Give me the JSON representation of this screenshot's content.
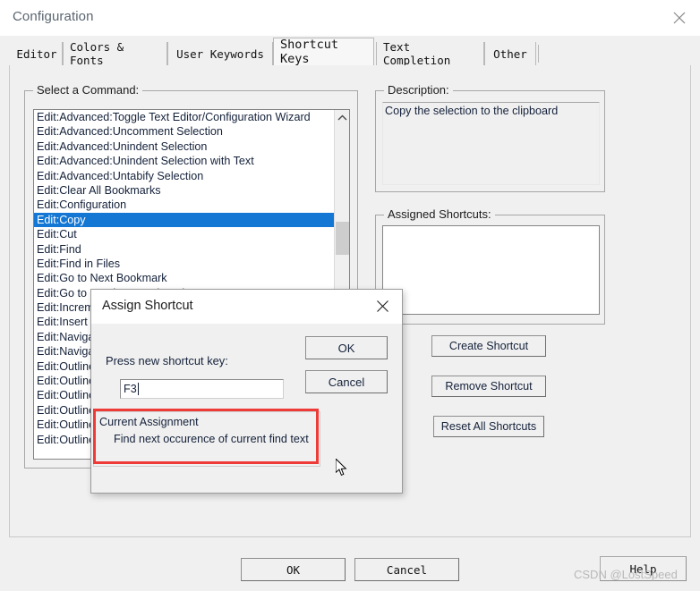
{
  "window": {
    "title": "Configuration",
    "close_icon": "close-icon"
  },
  "tabs": [
    {
      "label": "Editor",
      "active": false
    },
    {
      "label": "Colors & Fonts",
      "active": false
    },
    {
      "label": "User Keywords",
      "active": false
    },
    {
      "label": "Shortcut Keys",
      "active": true
    },
    {
      "label": "Text Completion",
      "active": false
    },
    {
      "label": "Other",
      "active": false
    }
  ],
  "command_group": {
    "label": "Select a Command:",
    "items": [
      {
        "text": "Edit:Advanced:Toggle Text Editor/Configuration Wizard",
        "selected": false
      },
      {
        "text": "Edit:Advanced:Uncomment Selection",
        "selected": false
      },
      {
        "text": "Edit:Advanced:Unindent Selection",
        "selected": false
      },
      {
        "text": "Edit:Advanced:Unindent Selection with Text",
        "selected": false
      },
      {
        "text": "Edit:Advanced:Untabify Selection",
        "selected": false
      },
      {
        "text": "Edit:Clear All Bookmarks",
        "selected": false
      },
      {
        "text": "Edit:Configuration",
        "selected": false
      },
      {
        "text": "Edit:Copy",
        "selected": true
      },
      {
        "text": "Edit:Cut",
        "selected": false
      },
      {
        "text": "Edit:Find",
        "selected": false
      },
      {
        "text": "Edit:Find in Files",
        "selected": false
      },
      {
        "text": "Edit:Go to Next Bookmark",
        "selected": false
      },
      {
        "text": "Edit:Go to Previous Bookmark",
        "selected": false
      },
      {
        "text": "Edit:Increment",
        "selected": false
      },
      {
        "text": "Edit:Insert",
        "selected": false
      },
      {
        "text": "Edit:Navigate",
        "selected": false
      },
      {
        "text": "Edit:Navigate",
        "selected": false
      },
      {
        "text": "Edit:Outline",
        "selected": false
      },
      {
        "text": "Edit:Outline",
        "selected": false
      },
      {
        "text": "Edit:Outline",
        "selected": false
      },
      {
        "text": "Edit:Outline",
        "selected": false
      },
      {
        "text": "Edit:Outline",
        "selected": false
      },
      {
        "text": "Edit:Outline",
        "selected": false
      }
    ],
    "scrollbar": {
      "up_arrow_icon": "chevron-up-icon"
    }
  },
  "description_group": {
    "label": "Description:",
    "text": "Copy the selection to the clipboard"
  },
  "assigned_group": {
    "label": "Assigned Shortcuts:",
    "items": []
  },
  "side_buttons": {
    "create": "Create Shortcut",
    "remove": "Remove Shortcut",
    "reset": "Reset All Shortcuts"
  },
  "footer": {
    "ok": "OK",
    "cancel": "Cancel",
    "help": "Help"
  },
  "dialog": {
    "title": "Assign Shortcut",
    "close_icon": "close-icon",
    "prompt": "Press new shortcut key:",
    "input_value": "F3",
    "input_placeholder": "",
    "ok": "OK",
    "cancel": "Cancel",
    "current_assignment": {
      "title": "Current Assignment",
      "text": "Find next occurence of current find text"
    }
  },
  "annotation": {
    "highlight_color": "#ef3b38"
  },
  "watermark": {
    "text": "CSDN @LostSpeed"
  }
}
